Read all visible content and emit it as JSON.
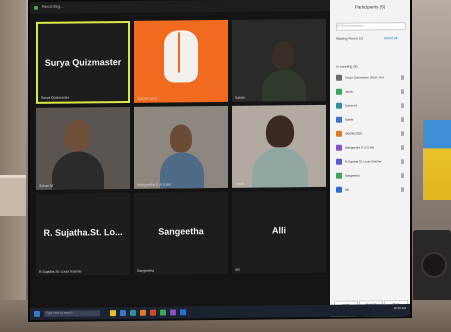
{
  "meeting": {
    "topbar_title": "Recording...",
    "tiles": [
      {
        "id": "t1",
        "big": "Surya Quizmaster",
        "name": "Surya Quizmaster"
      },
      {
        "id": "t2",
        "big": "",
        "name": "SMOM 2020"
      },
      {
        "id": "t3",
        "big": "",
        "name": "Sakthi"
      },
      {
        "id": "t4",
        "big": "",
        "name": "Sohan M"
      },
      {
        "id": "t5",
        "big": "",
        "name": "Mahgendra S Ji S.Sai"
      },
      {
        "id": "t6",
        "big": "",
        "name": "Jacob"
      },
      {
        "id": "t7",
        "big": "R. Sujatha.St. Lo...",
        "name": "R.Sujatha.St. Louis teacher"
      },
      {
        "id": "t8",
        "big": "Sangeetha",
        "name": "Sangeetha"
      },
      {
        "id": "t9",
        "big": "Alli",
        "name": "Alli"
      }
    ]
  },
  "participants_panel": {
    "title": "Participants (9)",
    "search_placeholder": "Q Find a participant",
    "section_waiting": "Waiting Room (1)",
    "admit_all": "Admit all",
    "section_in_meeting": "In meeting (9)",
    "rows": [
      {
        "name": "Surya Quizmaster (Host, me)",
        "color": "#6b6b6b"
      },
      {
        "name": "Jacob",
        "color": "#3aa656"
      },
      {
        "name": "Sohan M",
        "color": "#2f8f9e"
      },
      {
        "name": "Sakthi",
        "color": "#3a76c9"
      },
      {
        "name": "SMOM 2020",
        "color": "#e07a2a"
      },
      {
        "name": "Mahgendra S Ji S.Sai",
        "color": "#8a4fc2"
      },
      {
        "name": "R.Sujatha.St. Louis teacher",
        "color": "#5a5ac8"
      },
      {
        "name": "Sangeetha",
        "color": "#3aa656"
      },
      {
        "name": "Alli",
        "color": "#2a6fd0"
      }
    ],
    "buttons": [
      "Invite",
      "Mute All",
      "More"
    ]
  },
  "taskbar": {
    "search_placeholder": "Type here to search",
    "clock": "10:30 AM",
    "icon_colors": [
      "#e8c22a",
      "#3a76c9",
      "#2f8f9e",
      "#e07a2a",
      "#d64a2a",
      "#3aa656",
      "#8a4fc2",
      "#2a6fd0",
      "#3a76c9",
      "#e8c22a"
    ]
  }
}
